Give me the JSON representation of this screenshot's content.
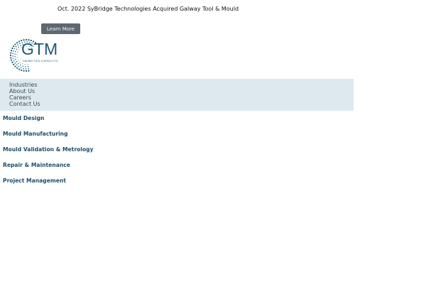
{
  "announcement": {
    "text": "Oct. 2022 SyBridge Technologies Acquired Galway Tool & Mould"
  },
  "cta": {
    "label": "Learn More"
  },
  "logo": {
    "text": "GTM",
    "subtitle": "GALWAY TOOL & MOULD LTD.",
    "color": "#1f5776",
    "dot_colors": [
      "#1f5776",
      "#2d8fa8"
    ]
  },
  "nav": {
    "items": [
      {
        "label": "Industries"
      },
      {
        "label": "About Us"
      },
      {
        "label": "Careers"
      },
      {
        "label": "Contact Us"
      }
    ],
    "background": "#dde9ee"
  },
  "services": {
    "items": [
      {
        "label": "Mould Design"
      },
      {
        "label": "Mould Manufacturing"
      },
      {
        "label": "Mould Validation & Metrology"
      },
      {
        "label": "Repair & Maintenance"
      },
      {
        "label": "Project Management"
      }
    ],
    "color": "#1d4e6c"
  }
}
